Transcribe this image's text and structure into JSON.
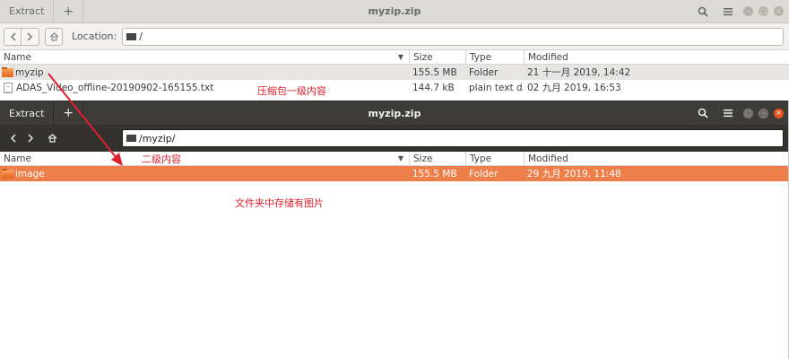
{
  "back_window": {
    "extract_label": "Extract",
    "new_label": "+",
    "title": "myzip.zip",
    "location_label": "Location:",
    "location_path": "/",
    "columns": {
      "name": "Name",
      "size": "Size",
      "type": "Type",
      "modified": "Modified"
    },
    "rows": [
      {
        "name": "myzip",
        "icon": "folder-icon",
        "size": "155.5 MB",
        "type": "Folder",
        "modified": "21 十一月 2019, 14:42"
      },
      {
        "name": "ADAS_Video_offline-20190902-165155.txt",
        "icon": "text-file-icon",
        "size": "144.7 kB",
        "type": "plain text d…",
        "modified": "02 九月 2019, 16:53"
      }
    ]
  },
  "front_window": {
    "extract_label": "Extract",
    "new_label": "+",
    "title": "myzip.zip",
    "location_path": "/myzip/",
    "columns": {
      "name": "Name",
      "size": "Size",
      "type": "Type",
      "modified": "Modified"
    },
    "rows": [
      {
        "name": "image",
        "icon": "folder-icon",
        "size": "155.5 MB",
        "type": "Folder",
        "modified": "29 九月 2019, 11:48"
      }
    ]
  },
  "annotations": {
    "first_level": "压缩包一级内容",
    "second_level": "二级内容",
    "folder_note": "文件夹中存储有图片"
  },
  "colors": {
    "selection_orange": "#ef7f4a",
    "annotation_red": "#e0202e",
    "dark_titlebar": "#3d3c38",
    "close_button": "#e95420"
  }
}
